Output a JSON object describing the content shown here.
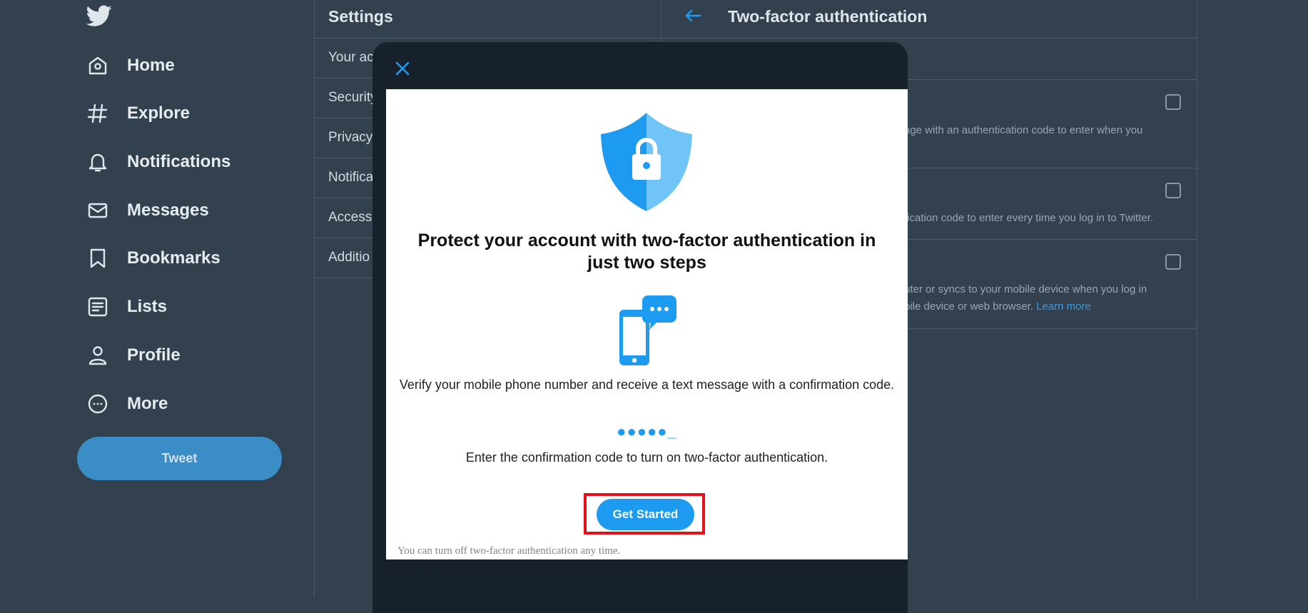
{
  "nav": {
    "items": [
      {
        "label": "Home",
        "icon": "home-icon"
      },
      {
        "label": "Explore",
        "icon": "hashtag-icon"
      },
      {
        "label": "Notifications",
        "icon": "bell-icon"
      },
      {
        "label": "Messages",
        "icon": "envelope-icon"
      },
      {
        "label": "Bookmarks",
        "icon": "bookmark-icon"
      },
      {
        "label": "Lists",
        "icon": "list-icon"
      },
      {
        "label": "Profile",
        "icon": "person-icon"
      },
      {
        "label": "More",
        "icon": "more-icon"
      }
    ],
    "tweet_label": "Tweet"
  },
  "settings": {
    "title": "Settings",
    "items": [
      "Your ac",
      "Security",
      "Privacy",
      "Notifica",
      "Accessil",
      "Additio"
    ]
  },
  "twofa": {
    "title": "Two-factor authentication",
    "row1_text": "age with an authentication code to enter when you",
    "row2_text": "fication code to enter every time you log in to Twitter.",
    "row3_text_a": "uter or syncs to your mobile device when you log in",
    "row3_text_b": "bile device or web browser.",
    "learn_more": "Learn more"
  },
  "modal": {
    "heading": "Protect your account with two-factor authentication in just two steps",
    "step1": "Verify your mobile phone number and receive a text message with a confirmation code.",
    "code_display": "●●●●●_",
    "step2": "Enter the confirmation code to turn on two-factor authentication.",
    "button_label": "Get Started",
    "footnote": "You can turn off two-factor authentication any time."
  },
  "colors": {
    "background": "#33414f",
    "accent": "#1d9bf0",
    "modal_dark": "#17212c",
    "highlight": "#e3121a"
  }
}
